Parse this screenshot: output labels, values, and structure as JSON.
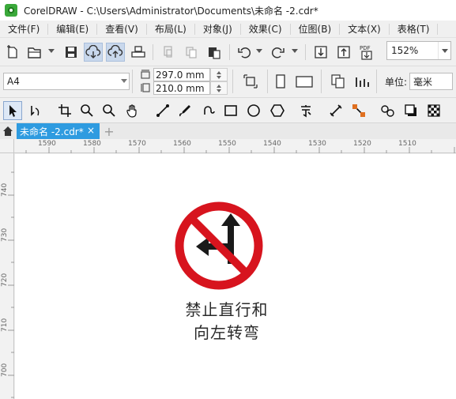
{
  "window": {
    "title": "CorelDRAW - C:\\Users\\Administrator\\Documents\\未命名 -2.cdr*"
  },
  "menu": {
    "items": [
      "文件(F)",
      "编辑(E)",
      "查看(V)",
      "布局(L)",
      "对象(J)",
      "效果(C)",
      "位图(B)",
      "文本(X)",
      "表格(T)"
    ]
  },
  "toolbar": {
    "zoom": "152%",
    "icons": [
      "new-document-icon",
      "open-folder-icon",
      "save-icon",
      "cloud-download-icon",
      "cloud-upload-icon",
      "print-icon",
      "cut-icon",
      "copy-icon",
      "paste-icon",
      "undo-icon",
      "redo-icon",
      "import-icon",
      "export-icon",
      "pdf-icon"
    ],
    "pdf_label": "PDF"
  },
  "property_bar": {
    "page_size": "A4",
    "width": "297.0 mm",
    "height": "210.0 mm",
    "unit_label": "单位:",
    "unit": "毫米"
  },
  "tabs": {
    "document": "未命名 -2.cdr*",
    "close": "×",
    "new": "+"
  },
  "rulers": {
    "horizontal": [
      "1590",
      "1580",
      "1570",
      "1560",
      "1550",
      "1540",
      "1530",
      "1520",
      "1510"
    ],
    "vertical": [
      "740",
      "730",
      "720",
      "710",
      "700"
    ]
  },
  "canvas": {
    "sign_line1": "禁止直行和",
    "sign_line2": "向左转弯"
  },
  "colors": {
    "sign_red": "#d7141e",
    "tab_blue": "#2e9be0",
    "logo_green": "#3aa83a"
  }
}
